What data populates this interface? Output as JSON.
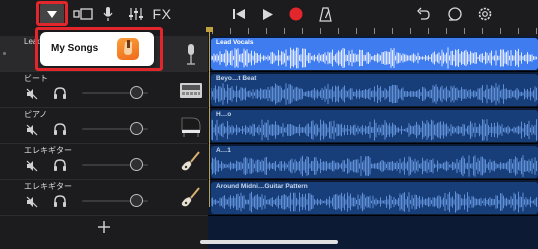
{
  "popup": {
    "label": "My Songs"
  },
  "toolbar": {
    "fx_label": "FX"
  },
  "tracks": [
    {
      "name": "Lead Vocals",
      "instrument": "microphone-icon",
      "volume": 0.0
    },
    {
      "name": "ビート",
      "instrument": "drum-machine-icon",
      "volume": 0.82
    },
    {
      "name": "ピアノ",
      "instrument": "grand-piano-icon",
      "volume": 0.82
    },
    {
      "name": "エレキギター",
      "instrument": "electric-guitar-icon",
      "volume": 0.82
    },
    {
      "name": "エレキギター",
      "instrument": "electric-guitar-icon",
      "volume": 0.82
    }
  ],
  "regions": [
    {
      "name": "Lead Vocals",
      "active": true
    },
    {
      "name": "Beyo…t Beat",
      "active": false
    },
    {
      "name": "H…o",
      "active": false
    },
    {
      "name": "A…1",
      "active": false
    },
    {
      "name": "Around Midni…Guitar Pattern",
      "active": false
    }
  ],
  "colors": {
    "accent": "#3f7cf0",
    "region_inactive": "#173e78",
    "record": "#e3262b",
    "highlight": "#e3262b"
  }
}
